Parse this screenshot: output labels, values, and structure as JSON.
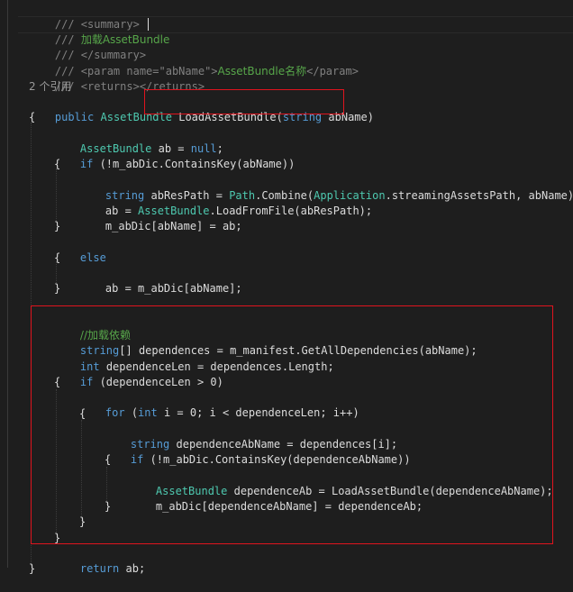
{
  "code": {
    "doc_summary_open": "/// <summary>",
    "doc_summary_prefix": "/// ",
    "doc_summary_text": "加载AssetBundle",
    "doc_summary_close": "/// </summary>",
    "doc_param_prefix": "/// <param name=\"abName\">",
    "doc_param_text": "AssetBundle名称",
    "doc_param_suffix": "</param>",
    "doc_returns": "/// <returns></returns>",
    "references": "2 个引用",
    "sig_public": "public",
    "sig_type": "AssetBundle",
    "sig_method": "LoadAssetBundle(",
    "sig_string": "string",
    "sig_param": " abName)",
    "brace_open": "{",
    "brace_close": "}",
    "l_ab_type": "AssetBundle",
    "l_ab_rest": " ab = ",
    "l_ab_null": "null",
    "l_ab_end": ";",
    "l_if_kw": "if",
    "l_if_rest": " (!m_abDic.ContainsKey(abName))",
    "l_path_string": "string",
    "l_path_mid": " abResPath = ",
    "l_path_type": "Path",
    "l_path_combine": ".Combine(",
    "l_path_app": "Application",
    "l_path_end": ".streamingAssetsPath, abName);",
    "l_load_pre": "ab = ",
    "l_load_type": "AssetBundle",
    "l_load_end": ".LoadFromFile(abResPath);",
    "l_assign": "m_abDic[abName] = ab;",
    "l_else": "else",
    "l_else_body": "ab = m_abDic[abName];",
    "l_dep_comment": "//加载依赖",
    "l_deps_kw": "string",
    "l_deps_rest": "[] dependences = m_manifest.GetAllDependencies(abName);",
    "l_len_kw": "int",
    "l_len_rest": " dependenceLen = dependences.Length;",
    "l_if2_kw": "if",
    "l_if2_rest": " (dependenceLen > 0)",
    "l_for_kw": "for",
    "l_for_open": " (",
    "l_for_int": "int",
    "l_for_rest": " i = 0; i < dependenceLen; i++)",
    "l_depname_kw": "string",
    "l_depname_rest": " dependenceAbName = dependences[i];",
    "l_if3_kw": "if",
    "l_if3_rest": " (!m_abDic.ContainsKey(dependenceAbName))",
    "l_depab_type": "AssetBundle",
    "l_depab_rest": " dependenceAb = LoadAssetBundle(dependenceAbName);",
    "l_depassign": "m_abDic[dependenceAbName] = dependenceAb;",
    "l_return_kw": "return",
    "l_return_rest": " ab;"
  },
  "colors": {
    "background": "#1e1e1e",
    "keyword": "#569cd6",
    "type": "#4ec9b0",
    "comment": "#57a64a",
    "highlight_box": "#e0141e"
  }
}
